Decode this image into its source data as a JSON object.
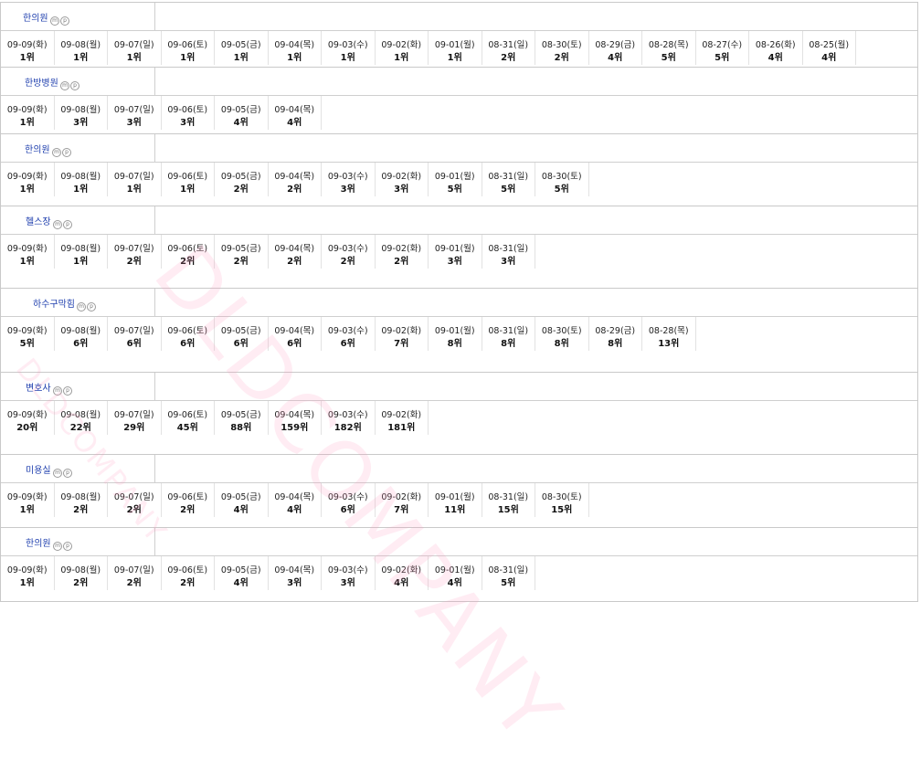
{
  "blocks": [
    {
      "keyword": "한의원",
      "ranks": [
        [
          "09-09(화)",
          "1위"
        ],
        [
          "09-08(월)",
          "1위"
        ],
        [
          "09-07(일)",
          "1위"
        ],
        [
          "09-06(토)",
          "1위"
        ],
        [
          "09-05(금)",
          "1위"
        ],
        [
          "09-04(목)",
          "1위"
        ],
        [
          "09-03(수)",
          "1위"
        ],
        [
          "09-02(화)",
          "1위"
        ],
        [
          "09-01(월)",
          "1위"
        ],
        [
          "08-31(일)",
          "2위"
        ],
        [
          "08-30(토)",
          "2위"
        ],
        [
          "08-29(금)",
          "4위"
        ],
        [
          "08-28(목)",
          "5위"
        ],
        [
          "08-27(수)",
          "5위"
        ],
        [
          "08-26(화)",
          "4위"
        ],
        [
          "08-25(월)",
          "4위"
        ]
      ]
    },
    {
      "keyword": "한방병원",
      "ranks": [
        [
          "09-09(화)",
          "1위"
        ],
        [
          "09-08(월)",
          "3위"
        ],
        [
          "09-07(일)",
          "3위"
        ],
        [
          "09-06(토)",
          "3위"
        ],
        [
          "09-05(금)",
          "4위"
        ],
        [
          "09-04(목)",
          "4위"
        ]
      ]
    },
    {
      "keyword": "한의원",
      "ranks": [
        [
          "09-09(화)",
          "1위"
        ],
        [
          "09-08(월)",
          "1위"
        ],
        [
          "09-07(일)",
          "1위"
        ],
        [
          "09-06(토)",
          "1위"
        ],
        [
          "09-05(금)",
          "2위"
        ],
        [
          "09-04(목)",
          "2위"
        ],
        [
          "09-03(수)",
          "3위"
        ],
        [
          "09-02(화)",
          "3위"
        ],
        [
          "09-01(월)",
          "5위"
        ],
        [
          "08-31(일)",
          "5위"
        ],
        [
          "08-30(토)",
          "5위"
        ]
      ]
    },
    {
      "keyword": "헬스장",
      "ranks": [
        [
          "09-09(화)",
          "1위"
        ],
        [
          "09-08(월)",
          "1위"
        ],
        [
          "09-07(일)",
          "2위"
        ],
        [
          "09-06(토)",
          "2위"
        ],
        [
          "09-05(금)",
          "2위"
        ],
        [
          "09-04(목)",
          "2위"
        ],
        [
          "09-03(수)",
          "2위"
        ],
        [
          "09-02(화)",
          "2위"
        ],
        [
          "09-01(월)",
          "3위"
        ],
        [
          "08-31(일)",
          "3위"
        ]
      ]
    },
    {
      "keyword": "하수구막힘",
      "ranks": [
        [
          "09-09(화)",
          "5위"
        ],
        [
          "09-08(월)",
          "6위"
        ],
        [
          "09-07(일)",
          "6위"
        ],
        [
          "09-06(토)",
          "6위"
        ],
        [
          "09-05(금)",
          "6위"
        ],
        [
          "09-04(목)",
          "6위"
        ],
        [
          "09-03(수)",
          "6위"
        ],
        [
          "09-02(화)",
          "7위"
        ],
        [
          "09-01(월)",
          "8위"
        ],
        [
          "08-31(일)",
          "8위"
        ],
        [
          "08-30(토)",
          "8위"
        ],
        [
          "08-29(금)",
          "8위"
        ],
        [
          "08-28(목)",
          "13위"
        ]
      ]
    },
    {
      "keyword": "변호사",
      "ranks": [
        [
          "09-09(화)",
          "20위"
        ],
        [
          "09-08(월)",
          "22위"
        ],
        [
          "09-07(일)",
          "29위"
        ],
        [
          "09-06(토)",
          "45위"
        ],
        [
          "09-05(금)",
          "88위"
        ],
        [
          "09-04(목)",
          "159위"
        ],
        [
          "09-03(수)",
          "182위"
        ],
        [
          "09-02(화)",
          "181위"
        ]
      ]
    },
    {
      "keyword": "미용실",
      "ranks": [
        [
          "09-09(화)",
          "1위"
        ],
        [
          "09-08(월)",
          "2위"
        ],
        [
          "09-07(일)",
          "2위"
        ],
        [
          "09-06(토)",
          "2위"
        ],
        [
          "09-05(금)",
          "4위"
        ],
        [
          "09-04(목)",
          "4위"
        ],
        [
          "09-03(수)",
          "6위"
        ],
        [
          "09-02(화)",
          "7위"
        ],
        [
          "09-01(월)",
          "11위"
        ],
        [
          "08-31(일)",
          "15위"
        ],
        [
          "08-30(토)",
          "15위"
        ]
      ]
    },
    {
      "keyword": "한의원",
      "ranks": [
        [
          "09-09(화)",
          "1위"
        ],
        [
          "09-08(월)",
          "2위"
        ],
        [
          "09-07(일)",
          "2위"
        ],
        [
          "09-06(토)",
          "2위"
        ],
        [
          "09-05(금)",
          "4위"
        ],
        [
          "09-04(목)",
          "3위"
        ],
        [
          "09-03(수)",
          "3위"
        ],
        [
          "09-02(화)",
          "4위"
        ],
        [
          "09-01(월)",
          "4위"
        ],
        [
          "08-31(일)",
          "5위"
        ]
      ]
    }
  ],
  "badges": [
    "m",
    "p"
  ],
  "watermark": "DLDCOMPANY",
  "watermark_small": "DLDCOMPANY",
  "colors": {
    "keyword": "#1f3fae",
    "watermark": "#ff96be",
    "border": "#c9c9c9"
  }
}
